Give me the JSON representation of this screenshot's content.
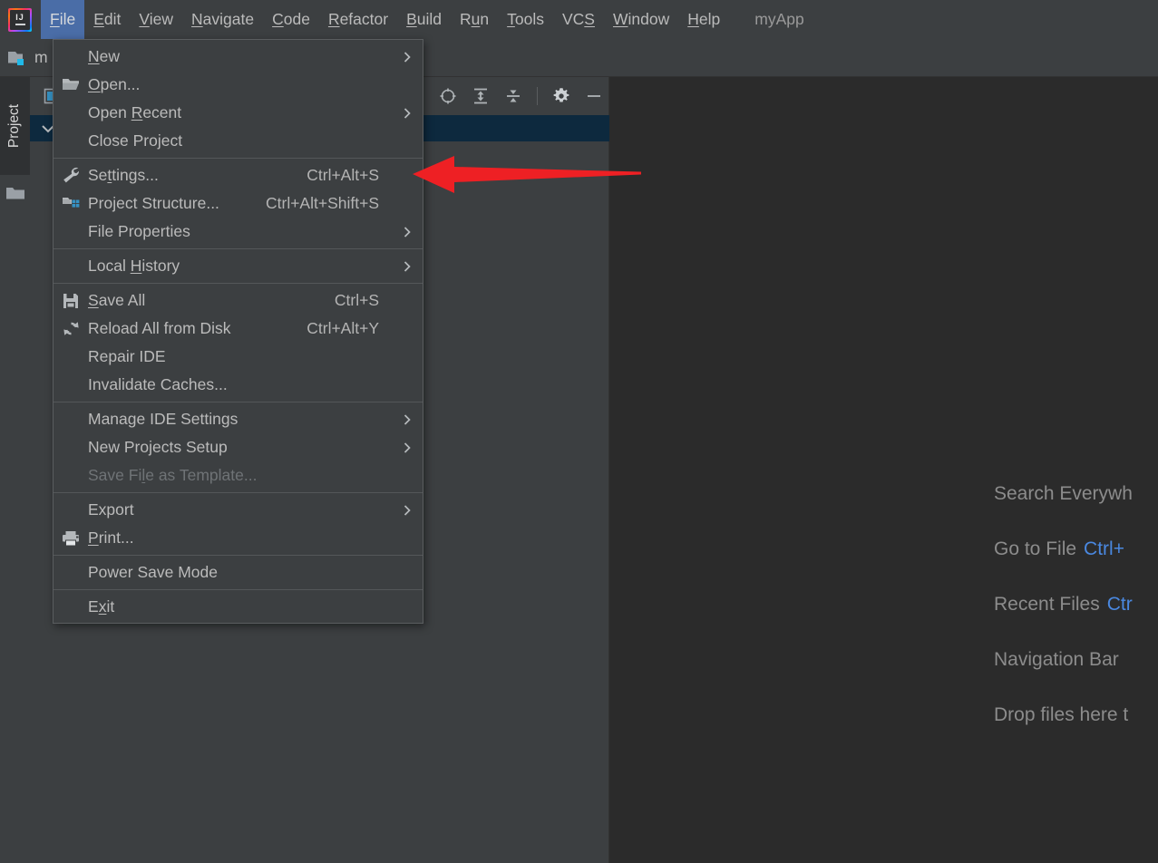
{
  "window": {
    "app_title": "myApp",
    "logo_text": "IJ"
  },
  "menubar": {
    "items": [
      {
        "label": "File",
        "mnemonic": "F",
        "active": true
      },
      {
        "label": "Edit",
        "mnemonic": "E",
        "active": false
      },
      {
        "label": "View",
        "mnemonic": "V",
        "active": false
      },
      {
        "label": "Navigate",
        "mnemonic": "N",
        "active": false
      },
      {
        "label": "Code",
        "mnemonic": "C",
        "active": false
      },
      {
        "label": "Refactor",
        "mnemonic": "R",
        "active": false
      },
      {
        "label": "Build",
        "mnemonic": "B",
        "active": false
      },
      {
        "label": "Run",
        "mnemonic": "u",
        "active": false
      },
      {
        "label": "Tools",
        "mnemonic": "T",
        "active": false
      },
      {
        "label": "VCS",
        "mnemonic": "S",
        "active": false
      },
      {
        "label": "Window",
        "mnemonic": "W",
        "active": false
      },
      {
        "label": "Help",
        "mnemonic": "H",
        "active": false
      }
    ]
  },
  "navbar": {
    "module_label": "m",
    "module_icon": "module-folder-icon"
  },
  "stripe": {
    "project_tab_label": "Project",
    "folder_icon": "folder-icon"
  },
  "toolwindow": {
    "tab_icon": "project-tab-icon",
    "actions": [
      {
        "name": "select-opened-file-icon",
        "title": "Select Opened File"
      },
      {
        "name": "expand-all-icon",
        "title": "Expand All"
      },
      {
        "name": "collapse-all-icon",
        "title": "Collapse All"
      },
      {
        "name": "settings-gear-icon",
        "title": "Options"
      },
      {
        "name": "hide-icon",
        "title": "Hide"
      }
    ]
  },
  "file_menu": {
    "items": [
      {
        "label": "New",
        "mnemonic": "N",
        "icon": null,
        "shortcut": "",
        "submenu": true,
        "disabled": false,
        "sep_after": false
      },
      {
        "label": "Open...",
        "mnemonic": "O",
        "icon": "open-folder-icon",
        "shortcut": "",
        "submenu": false,
        "disabled": false,
        "sep_after": false
      },
      {
        "label": "Open Recent",
        "mnemonic": "R",
        "icon": null,
        "shortcut": "",
        "submenu": true,
        "disabled": false,
        "sep_after": false
      },
      {
        "label": "Close Project",
        "mnemonic": "",
        "icon": null,
        "shortcut": "",
        "submenu": false,
        "disabled": false,
        "sep_after": true
      },
      {
        "label": "Settings...",
        "mnemonic": "t",
        "icon": "wrench-icon",
        "shortcut": "Ctrl+Alt+S",
        "submenu": false,
        "disabled": false,
        "sep_after": false
      },
      {
        "label": "Project Structure...",
        "mnemonic": "",
        "icon": "project-structure-icon",
        "shortcut": "Ctrl+Alt+Shift+S",
        "submenu": false,
        "disabled": false,
        "sep_after": false
      },
      {
        "label": "File Properties",
        "mnemonic": "",
        "icon": null,
        "shortcut": "",
        "submenu": true,
        "disabled": false,
        "sep_after": true
      },
      {
        "label": "Local History",
        "mnemonic": "H",
        "icon": null,
        "shortcut": "",
        "submenu": true,
        "disabled": false,
        "sep_after": true
      },
      {
        "label": "Save All",
        "mnemonic": "S",
        "icon": "save-floppy-icon",
        "shortcut": "Ctrl+S",
        "submenu": false,
        "disabled": false,
        "sep_after": false
      },
      {
        "label": "Reload All from Disk",
        "mnemonic": "",
        "icon": "reload-icon",
        "shortcut": "Ctrl+Alt+Y",
        "submenu": false,
        "disabled": false,
        "sep_after": false
      },
      {
        "label": "Repair IDE",
        "mnemonic": "",
        "icon": null,
        "shortcut": "",
        "submenu": false,
        "disabled": false,
        "sep_after": false
      },
      {
        "label": "Invalidate Caches...",
        "mnemonic": "",
        "icon": null,
        "shortcut": "",
        "submenu": false,
        "disabled": false,
        "sep_after": true
      },
      {
        "label": "Manage IDE Settings",
        "mnemonic": "",
        "icon": null,
        "shortcut": "",
        "submenu": true,
        "disabled": false,
        "sep_after": false
      },
      {
        "label": "New Projects Setup",
        "mnemonic": "",
        "icon": null,
        "shortcut": "",
        "submenu": true,
        "disabled": false,
        "sep_after": false
      },
      {
        "label": "Save File as Template...",
        "mnemonic": "l",
        "icon": null,
        "shortcut": "",
        "submenu": false,
        "disabled": true,
        "sep_after": true
      },
      {
        "label": "Export",
        "mnemonic": "",
        "icon": null,
        "shortcut": "",
        "submenu": true,
        "disabled": false,
        "sep_after": false
      },
      {
        "label": "Print...",
        "mnemonic": "P",
        "icon": "printer-icon",
        "shortcut": "",
        "submenu": false,
        "disabled": false,
        "sep_after": true
      },
      {
        "label": "Power Save Mode",
        "mnemonic": "",
        "icon": null,
        "shortcut": "",
        "submenu": false,
        "disabled": false,
        "sep_after": true
      },
      {
        "label": "Exit",
        "mnemonic": "x",
        "icon": null,
        "shortcut": "",
        "submenu": false,
        "disabled": false,
        "sep_after": false
      }
    ]
  },
  "editor_hints": {
    "rows": [
      {
        "text": "Search Everywh",
        "shortcut": ""
      },
      {
        "text": "Go to File",
        "shortcut": "Ctrl+"
      },
      {
        "text": "Recent Files",
        "shortcut": "Ctr"
      },
      {
        "text": "Navigation Bar",
        "shortcut": ""
      },
      {
        "text": "Drop files here t",
        "shortcut": ""
      }
    ]
  },
  "annotation": {
    "arrow_name": "red-pointer-arrow",
    "color": "#ee2024",
    "points_at": "Settings..."
  },
  "colors": {
    "window_bg": "#2b2b2b",
    "panel_bg": "#3c3f41",
    "menu_highlight": "#4a6da7",
    "selection_row": "#0d293e",
    "text": "#bbbbbb",
    "text_disabled": "#6f7376",
    "shortcut_blue": "#4a88e0",
    "annotation_red": "#ee2024"
  }
}
